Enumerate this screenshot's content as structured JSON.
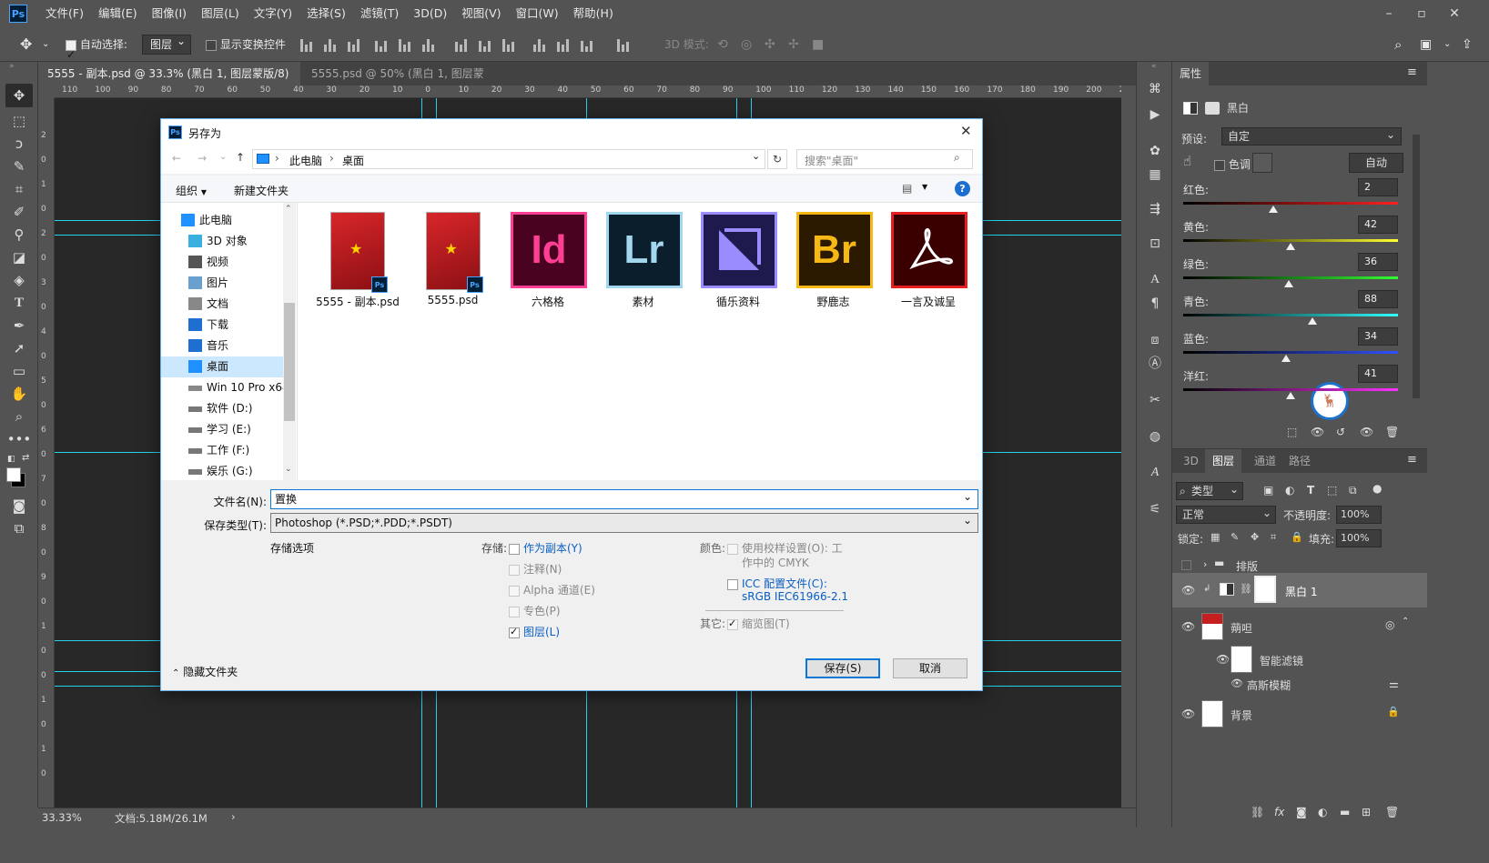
{
  "menubar": {
    "logo": "Ps",
    "items": [
      "文件(F)",
      "编辑(E)",
      "图像(I)",
      "图层(L)",
      "文字(Y)",
      "选择(S)",
      "滤镜(T)",
      "3D(D)",
      "视图(V)",
      "窗口(W)",
      "帮助(H)"
    ]
  },
  "options": {
    "auto_select_label": "自动选择:",
    "auto_select_target": "图层",
    "show_transform_label": "显示变换控件",
    "mode_3d_label": "3D 模式:"
  },
  "tabs": [
    {
      "label": "5555 - 副本.psd @ 33.3% (黑白 1, 图层蒙版/8) *",
      "close": "×"
    },
    {
      "label": "5555.psd @ 50% (黑白 1, 图层蒙版/8)",
      "close": "×"
    }
  ],
  "rulers": {
    "h_ticks": [
      "110",
      "100",
      "90",
      "80",
      "70",
      "60",
      "50",
      "40",
      "30",
      "20",
      "10",
      "0",
      "10",
      "20",
      "30",
      "40",
      "50",
      "60",
      "70",
      "80",
      "90",
      "100",
      "110",
      "120",
      "130",
      "140",
      "150",
      "160",
      "170",
      "180",
      "190",
      "200",
      "210"
    ],
    "v_ticks": [
      "2",
      "0",
      "1",
      "0",
      "2",
      "0",
      "3",
      "0",
      "4",
      "0",
      "5",
      "0",
      "6",
      "0",
      "7",
      "0",
      "8",
      "0",
      "9",
      "0",
      "1",
      "0",
      "0",
      "1",
      "0",
      "1",
      "0"
    ]
  },
  "status": {
    "zoom": "33.33%",
    "doc": "文档:5.18M/26.1M",
    "arrow": "›"
  },
  "properties": {
    "title": "属性",
    "adjustment_name": "黑白",
    "preset_label": "预设:",
    "preset_value": "自定",
    "tint_label": "色调",
    "auto_button": "自动",
    "sliders": [
      {
        "label": "红色:",
        "value": "2",
        "pos": 0.42
      },
      {
        "label": "黄色:",
        "value": "42",
        "pos": 0.5
      },
      {
        "label": "绿色:",
        "value": "36",
        "pos": 0.49
      },
      {
        "label": "青色:",
        "value": "88",
        "pos": 0.6
      },
      {
        "label": "蓝色:",
        "value": "34",
        "pos": 0.48
      },
      {
        "label": "洋红:",
        "value": "41",
        "pos": 0.5
      }
    ]
  },
  "layers_panel": {
    "tabs": [
      "3D",
      "图层",
      "通道",
      "路径"
    ],
    "active_tab": "图层",
    "kind_filter": "类型",
    "blend_mode": "正常",
    "opacity_label": "不透明度:",
    "opacity_value": "100%",
    "lock_label": "锁定:",
    "fill_label": "填充:",
    "fill_value": "100%",
    "layers": [
      {
        "name": "排版",
        "type": "group"
      },
      {
        "name": "黑白 1",
        "type": "adjustment"
      },
      {
        "name": "蒴呾",
        "type": "smart"
      },
      {
        "name": "智能滤镜",
        "type": "filter-mask"
      },
      {
        "name": "高斯模糊",
        "type": "filter"
      },
      {
        "name": "背景",
        "type": "background"
      }
    ]
  },
  "dialog": {
    "title": "另存为",
    "path": [
      "此电脑",
      "桌面"
    ],
    "search_placeholder": "搜索\"桌面\"",
    "organize": "组织",
    "new_folder": "新建文件夹",
    "tree": [
      {
        "label": "此电脑",
        "indent": 0
      },
      {
        "label": "3D 对象",
        "indent": 1
      },
      {
        "label": "视频",
        "indent": 1
      },
      {
        "label": "图片",
        "indent": 1
      },
      {
        "label": "文档",
        "indent": 1
      },
      {
        "label": "下载",
        "indent": 1
      },
      {
        "label": "音乐",
        "indent": 1
      },
      {
        "label": "桌面",
        "indent": 1,
        "selected": true
      },
      {
        "label": "Win 10 Pro x64",
        "indent": 1
      },
      {
        "label": "软件 (D:)",
        "indent": 1
      },
      {
        "label": "学习 (E:)",
        "indent": 1
      },
      {
        "label": "工作 (F:)",
        "indent": 1
      },
      {
        "label": "娱乐 (G:)",
        "indent": 1
      }
    ],
    "files": [
      {
        "name": "5555 - 副本.psd",
        "kind": "psd"
      },
      {
        "name": "5555.psd",
        "kind": "psd"
      },
      {
        "name": "六格格",
        "kind": "app",
        "glyph": "Id",
        "bg": "#49021f",
        "fg": "#ff3f94"
      },
      {
        "name": "素材",
        "kind": "app",
        "glyph": "Lr",
        "bg": "#0a1f2b",
        "fg": "#a3d6ef"
      },
      {
        "name": "循乐资料",
        "kind": "app",
        "glyph": "",
        "bg": "#1f1a4e",
        "fg": "#9a8cff"
      },
      {
        "name": "野鹿志",
        "kind": "app",
        "glyph": "Br",
        "bg": "#2b1a00",
        "fg": "#f7b815"
      },
      {
        "name": "一言及诚呈",
        "kind": "app",
        "glyph": "",
        "bg": "#3a0000",
        "fg": "#e61e1e"
      }
    ],
    "filename_label": "文件名(N):",
    "filename_value": "置换",
    "filetype_label": "保存类型(T):",
    "filetype_value": "Photoshop (*.PSD;*.PDD;*.PSDT)",
    "save_options_label": "存储选项",
    "store_label": "存储:",
    "store_options": [
      {
        "label": "作为副本(Y)",
        "checked": false,
        "enabled": true
      },
      {
        "label": "注释(N)",
        "checked": false,
        "enabled": false
      },
      {
        "label": "Alpha 通道(E)",
        "checked": false,
        "enabled": false
      },
      {
        "label": "专色(P)",
        "checked": false,
        "enabled": false
      },
      {
        "label": "图层(L)",
        "checked": true,
        "enabled": true
      }
    ],
    "color_label": "颜色:",
    "proof_label": "使用校样设置(O): 工",
    "proof_label2": "作中的 CMYK",
    "icc_label": "ICC 配置文件(C):",
    "icc_value": "sRGB IEC61966-2.1",
    "other_label": "其它:",
    "thumbnail_label": "缩览图(T)",
    "hide_folders": "隐藏文件夹",
    "save_button": "保存(S)",
    "cancel_button": "取消"
  }
}
